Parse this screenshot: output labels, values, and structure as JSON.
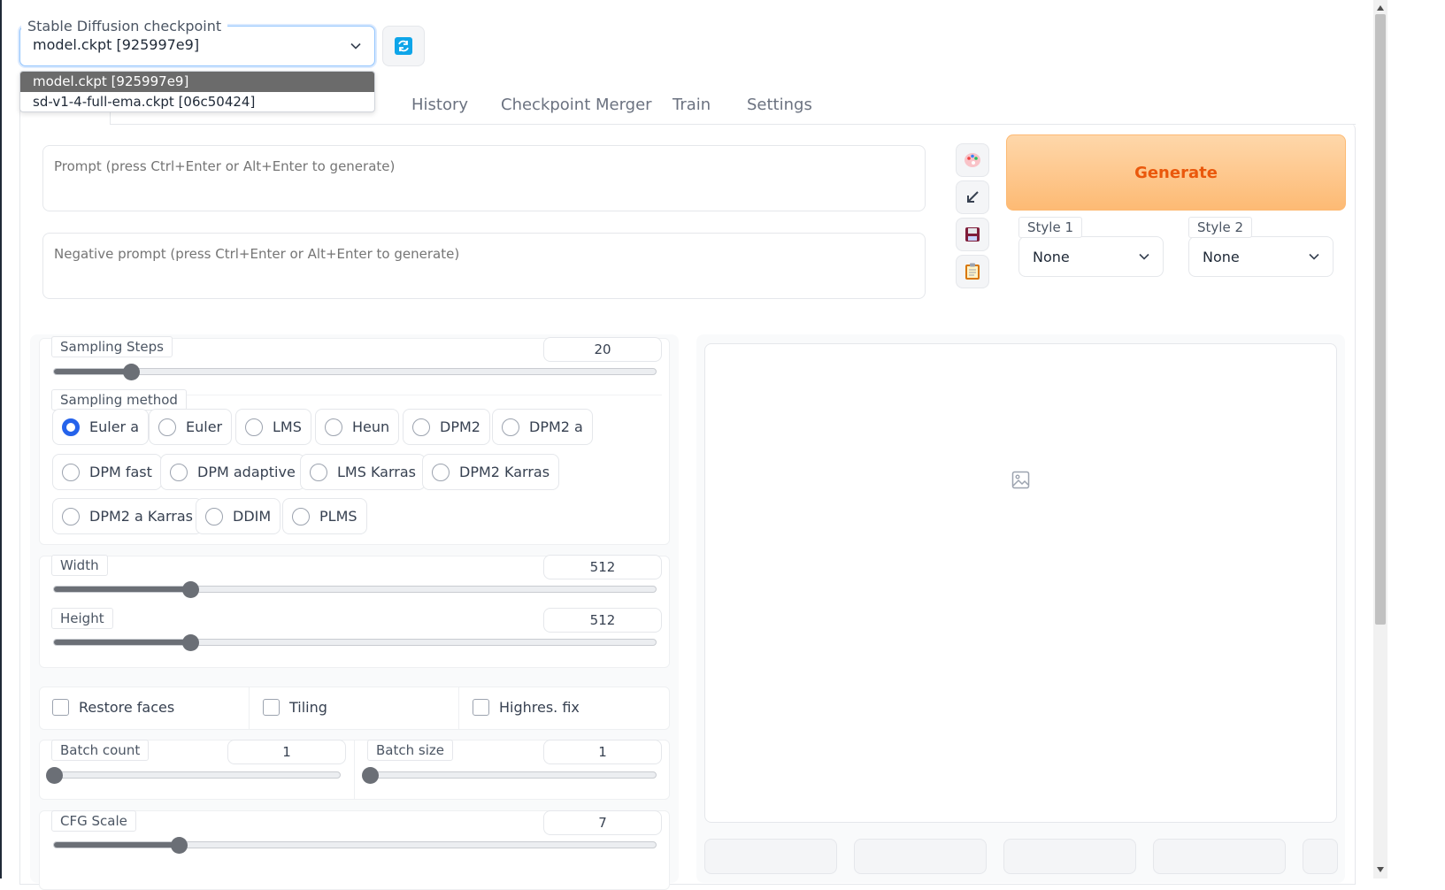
{
  "checkpoint": {
    "label": "Stable Diffusion checkpoint",
    "value": "model.ckpt [925997e9]",
    "options": [
      "model.ckpt [925997e9]",
      "sd-v1-4-full-ema.ckpt [06c50424]"
    ]
  },
  "tabs": [
    {
      "label": "History"
    },
    {
      "label": "Checkpoint Merger"
    },
    {
      "label": "Train"
    },
    {
      "label": "Settings"
    }
  ],
  "prompt": {
    "placeholder": "Prompt (press Ctrl+Enter or Alt+Enter to generate)"
  },
  "negative_prompt": {
    "placeholder": "Negative prompt (press Ctrl+Enter or Alt+Enter to generate)"
  },
  "tool_icons": [
    "palette-icon",
    "arrow-down-left-icon",
    "floppy-disk-icon",
    "clipboard-icon"
  ],
  "generate": {
    "label": "Generate",
    "color": "#ea580c"
  },
  "styles": [
    {
      "label": "Style 1",
      "value": "None"
    },
    {
      "label": "Style 2",
      "value": "None"
    }
  ],
  "sampling_steps": {
    "label": "Sampling Steps",
    "value": "20",
    "min": 1,
    "max": 150,
    "num": 20
  },
  "sampling_method": {
    "label": "Sampling method",
    "selected": "Euler a",
    "options": [
      "Euler a",
      "Euler",
      "LMS",
      "Heun",
      "DPM2",
      "DPM2 a",
      "DPM fast",
      "DPM adaptive",
      "LMS Karras",
      "DPM2 Karras",
      "DPM2 a Karras",
      "DDIM",
      "PLMS"
    ]
  },
  "width": {
    "label": "Width",
    "value": "512",
    "min": 64,
    "max": 2048,
    "num": 512
  },
  "height": {
    "label": "Height",
    "value": "512",
    "min": 64,
    "max": 2048,
    "num": 512
  },
  "checkboxes": [
    {
      "label": "Restore faces",
      "checked": false
    },
    {
      "label": "Tiling",
      "checked": false
    },
    {
      "label": "Highres. fix",
      "checked": false
    }
  ],
  "batch_count": {
    "label": "Batch count",
    "value": "1",
    "min": 1,
    "max": 100,
    "num": 1
  },
  "batch_size": {
    "label": "Batch size",
    "value": "1",
    "min": 1,
    "max": 8,
    "num": 1
  },
  "cfg_scale": {
    "label": "CFG Scale",
    "value": "7",
    "min": 1,
    "max": 30,
    "num": 7
  },
  "output": {
    "placeholder_icon": "image-icon"
  },
  "colors": {
    "accent": "#2563eb",
    "generate_bg_start": "#fed7aa",
    "generate_bg_end": "#fdba74"
  }
}
